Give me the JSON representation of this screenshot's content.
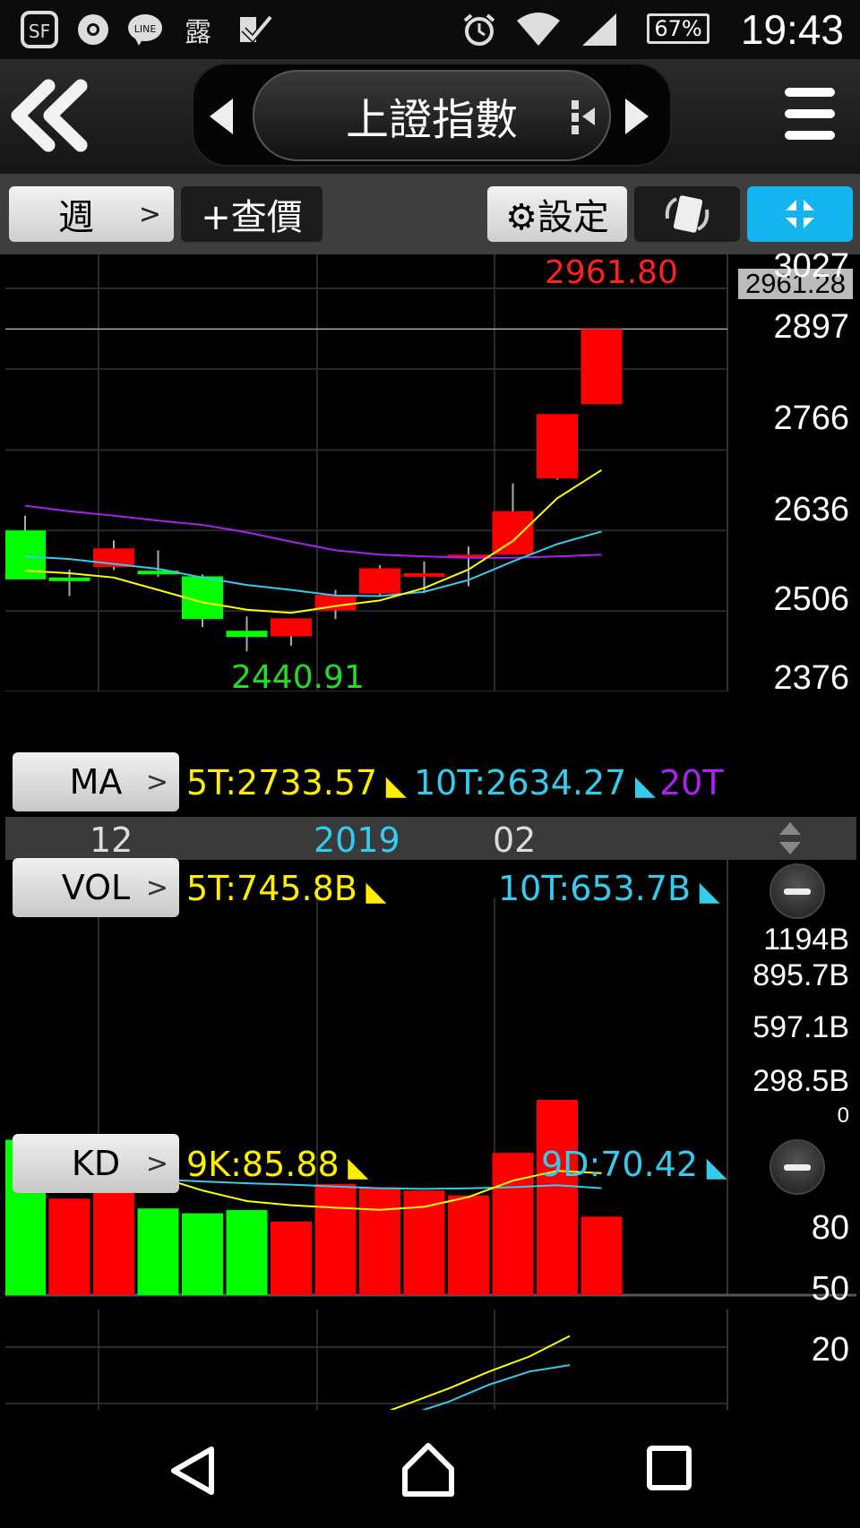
{
  "status_bar": {
    "icons_left": [
      "sf-app-icon",
      "chrome-icon",
      "line-icon",
      "lu-app-icon",
      "check-app-icon"
    ],
    "lu_glyph": "露",
    "battery": "67%",
    "time": "19:43"
  },
  "nav": {
    "title": "上證指數"
  },
  "toolbar": {
    "period_label": "週",
    "quote_label": "+查價",
    "settings_label": "⚙設定"
  },
  "price_chart": {
    "high_label": "2961.80",
    "low_label": "2440.91",
    "current_price": "2961.28",
    "y_labels": [
      "3027",
      "2897",
      "2766",
      "2636",
      "2506",
      "2376"
    ]
  },
  "ma": {
    "button_label": "MA",
    "ma5": "5T:2733.57",
    "ma10": "10T:2634.27",
    "ma20": "20T"
  },
  "time_axis": {
    "labels": [
      "12",
      "2019",
      "02"
    ]
  },
  "vol": {
    "button_label": "VOL",
    "ma5": "5T:745.8B",
    "ma10": "10T:653.7B",
    "y_labels": [
      "1194B",
      "895.7B",
      "597.1B",
      "298.5B",
      "0"
    ]
  },
  "kd": {
    "button_label": "KD",
    "k": "9K:85.88",
    "d": "9D:70.42",
    "y_labels": [
      "80",
      "50",
      "20"
    ]
  },
  "colors": {
    "up": "#ff0000",
    "down": "#00ff00",
    "ma5": "#ffff00",
    "ma10": "#33ccee",
    "ma20": "#aa22ee",
    "accent": "#14b4f0"
  },
  "chart_data": [
    {
      "type": "candlestick",
      "title": "上證指數",
      "period": "週",
      "candles": [
        {
          "open": 2636,
          "close": 2557,
          "high": 2660,
          "low": 2557
        },
        {
          "open": 2560,
          "close": 2555,
          "high": 2573,
          "low": 2530
        },
        {
          "open": 2577,
          "close": 2607,
          "high": 2620,
          "low": 2572
        },
        {
          "open": 2571,
          "close": 2570,
          "high": 2604,
          "low": 2561
        },
        {
          "open": 2562,
          "close": 2493,
          "high": 2565,
          "low": 2480
        },
        {
          "open": 2474,
          "close": 2464,
          "high": 2497,
          "low": 2440.91
        },
        {
          "open": 2465,
          "close": 2494,
          "high": 2494,
          "low": 2450
        },
        {
          "open": 2507,
          "close": 2532,
          "high": 2540,
          "low": 2493
        },
        {
          "open": 2534,
          "close": 2575,
          "high": 2580,
          "low": 2530
        },
        {
          "open": 2565,
          "close": 2567,
          "high": 2586,
          "low": 2535
        },
        {
          "open": 2597,
          "close": 2597,
          "high": 2610,
          "low": 2546
        },
        {
          "open": 2597,
          "close": 2667,
          "high": 2712,
          "low": 2597
        },
        {
          "open": 2720,
          "close": 2824,
          "high": 2824,
          "low": 2718
        },
        {
          "open": 2840,
          "close": 2961.28,
          "high": 2961.8,
          "low": 2840
        }
      ],
      "ma5": [
        2571,
        2567,
        2560,
        2540,
        2520,
        2508,
        2503,
        2514,
        2523,
        2543,
        2573,
        2619,
        2688,
        2733.57
      ],
      "ma10": [
        2594,
        2590,
        2582,
        2574,
        2560,
        2548,
        2540,
        2531,
        2530,
        2537,
        2556,
        2586,
        2614,
        2634.27
      ],
      "ma20": [
        2676,
        2667,
        2660,
        2652,
        2645,
        2633,
        2618,
        2604,
        2597,
        2594,
        2592,
        2592,
        2594,
        2597
      ],
      "y_ticks": [
        3027,
        2897,
        2766,
        2636,
        2506,
        2376
      ],
      "ylim": [
        2376,
        3027
      ]
    },
    {
      "type": "bar",
      "title": "VOL",
      "unit": "B",
      "values": [
        950,
        590,
        720,
        530,
        500,
        520,
        450,
        680,
        660,
        640,
        610,
        870,
        1194,
        480
      ],
      "up": [
        false,
        true,
        true,
        false,
        false,
        false,
        true,
        true,
        true,
        true,
        true,
        true,
        true,
        true
      ],
      "ma5": [
        800,
        780,
        760,
        725,
        640,
        575,
        550,
        535,
        522,
        540,
        600,
        700,
        760,
        745.8
      ],
      "ma10": [
        700,
        705,
        710,
        708,
        695,
        684,
        676,
        664,
        654,
        650,
        653,
        660,
        672,
        653.7
      ],
      "y_ticks": [
        1194,
        895.7,
        597.1,
        298.5,
        0
      ],
      "ylim": [
        0,
        1194
      ]
    },
    {
      "type": "line",
      "title": "KD",
      "series": [
        {
          "name": "9K",
          "values": [
            40,
            37,
            39,
            42,
            27,
            20,
            20,
            25,
            33,
            42,
            50,
            58,
            67,
            75,
            85.88
          ]
        },
        {
          "name": "9D",
          "values": [
            40,
            39,
            40,
            40,
            35,
            33,
            30,
            30,
            32,
            37,
            44,
            51,
            60,
            67,
            70.42
          ]
        }
      ],
      "y_ticks": [
        80,
        50,
        20
      ],
      "ylim": [
        0,
        100
      ]
    }
  ]
}
